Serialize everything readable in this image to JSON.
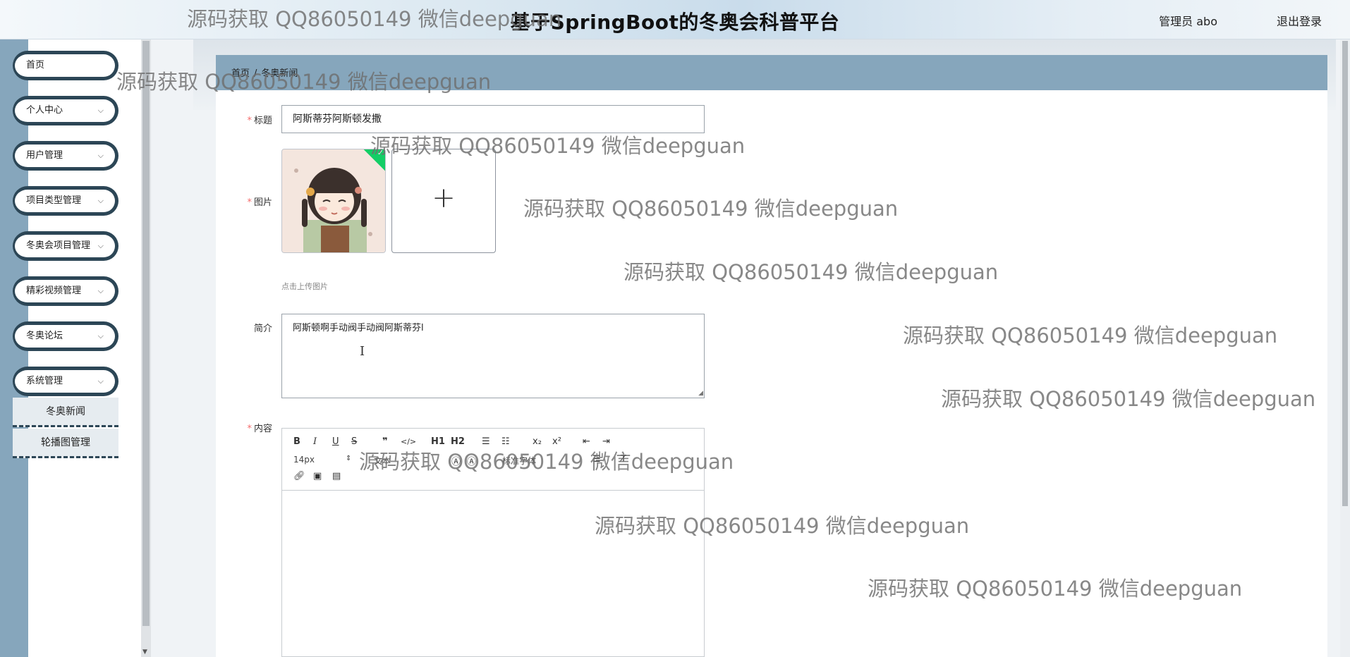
{
  "header": {
    "title": "基于SpringBoot的冬奥会科普平台",
    "user": "管理员 abo",
    "logout": "退出登录"
  },
  "sidebar": {
    "items": [
      {
        "label": "首页",
        "has_chevron": false
      },
      {
        "label": "个人中心",
        "has_chevron": true
      },
      {
        "label": "用户管理",
        "has_chevron": true
      },
      {
        "label": "项目类型管理",
        "has_chevron": true
      },
      {
        "label": "冬奥会项目管理",
        "has_chevron": true
      },
      {
        "label": "精彩视频管理",
        "has_chevron": true
      },
      {
        "label": "冬奥论坛",
        "has_chevron": true
      },
      {
        "label": "系统管理",
        "has_chevron": true
      }
    ],
    "subitems": [
      {
        "label": "冬奥新闻"
      },
      {
        "label": "轮播图管理"
      }
    ],
    "chevron": "⌵"
  },
  "breadcrumb": {
    "home": "首页",
    "separator": "/",
    "current": "冬奥新闻"
  },
  "form": {
    "title_label": "标题",
    "title_value": "阿斯蒂芬阿斯顿发撒",
    "image_label": "图片",
    "upload_plus": "+",
    "upload_tip": "点击上传图片",
    "intro_label": "简介",
    "intro_value": "阿斯顿啊手动阀手动阀阿斯蒂芬l",
    "content_label": "内容",
    "required_mark": "*"
  },
  "editor": {
    "toolbar_row1": [
      "B",
      "I",
      "U",
      "S",
      "❞",
      "</>",
      "H1",
      "H2",
      "☰",
      "☷",
      "x₂",
      "x²",
      "⇤",
      "⇥"
    ],
    "font_size": "14px",
    "font_size_arrow": "⇕",
    "text_label": "文本",
    "header_label": "标准字体",
    "toolbar_row3_icons": [
      "link-icon",
      "image-icon",
      "video-icon"
    ]
  },
  "watermark": {
    "text": "源码获取 QQ86050149 微信deepguan"
  },
  "colors": {
    "sidebar_rail": "#86a6bc",
    "menu_border": "#2c4656",
    "required": "#f56c6c",
    "upload_ok": "#13ce66"
  }
}
